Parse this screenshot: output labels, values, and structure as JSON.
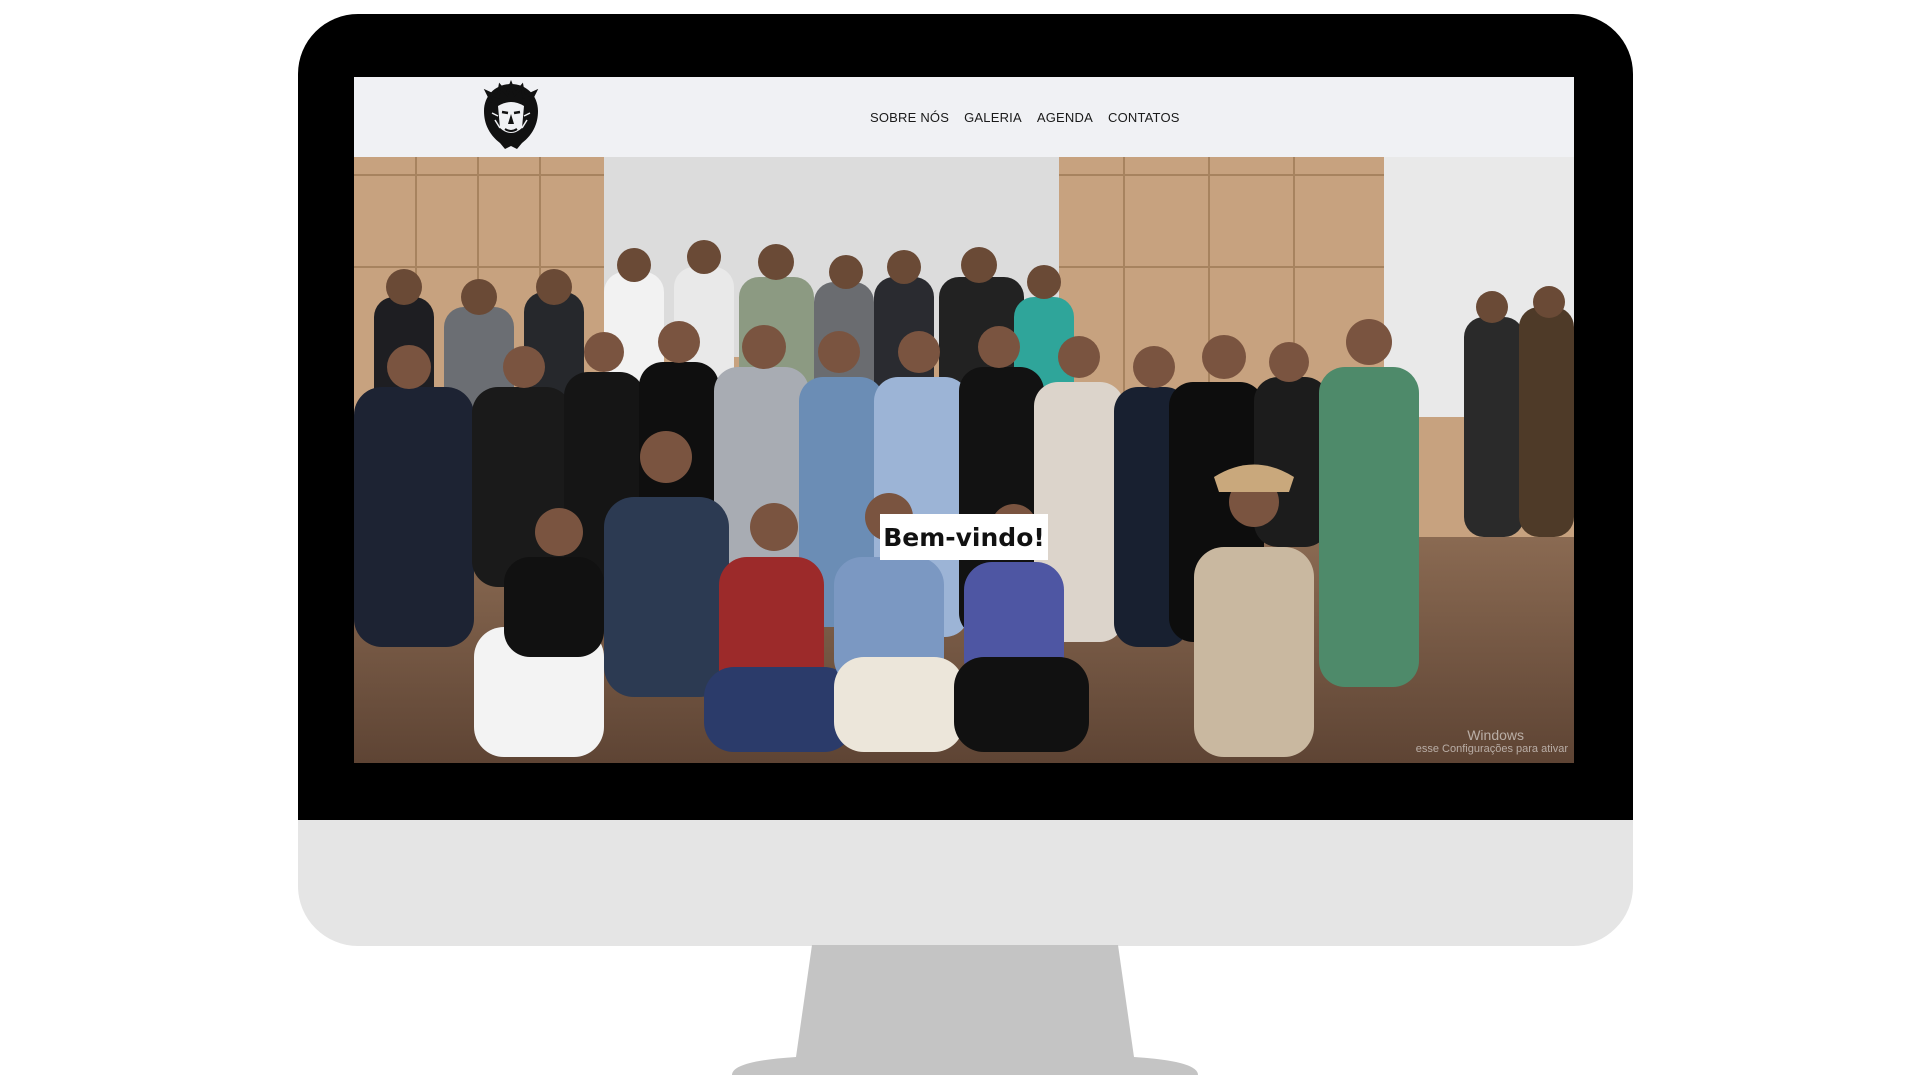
{
  "site": {
    "nav": [
      {
        "label": "SOBRE NÓS"
      },
      {
        "label": "GALERIA"
      },
      {
        "label": "AGENDA"
      },
      {
        "label": "CONTATOS"
      }
    ],
    "logo_icon": "lion-head-icon"
  },
  "hero": {
    "welcome": "Bem-vindo!",
    "watermark_line1": "Windows",
    "watermark_line2": "esse Configurações para ativar"
  },
  "colors": {
    "header_bg": "#f0f1f4",
    "bezel": "#000000",
    "chin": "#e5e5e5",
    "stand": "#c4c4c4"
  }
}
